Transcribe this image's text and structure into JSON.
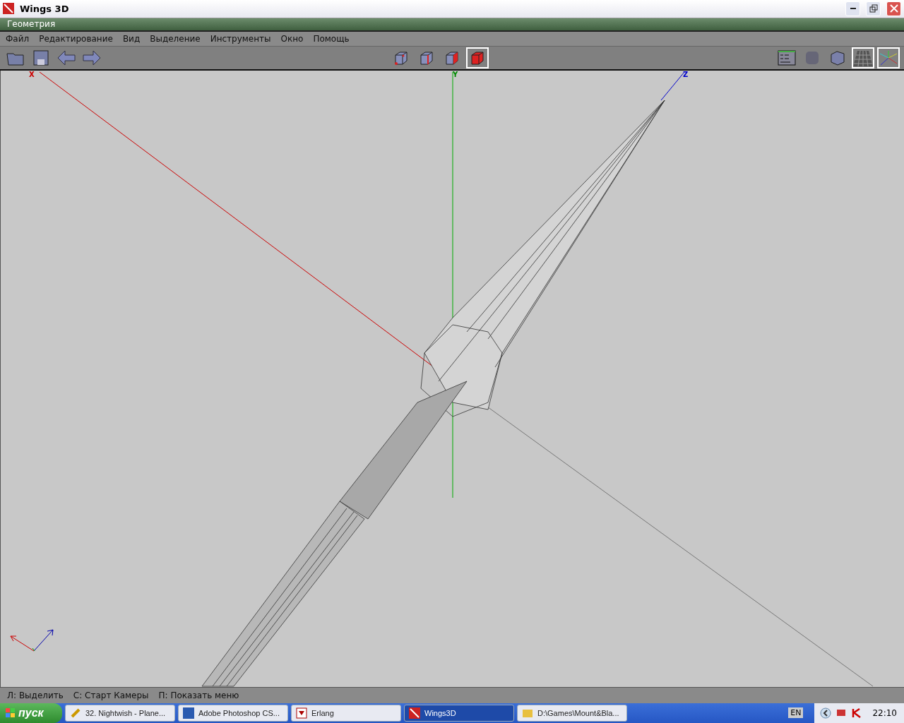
{
  "window": {
    "title": "Wings 3D"
  },
  "geometry_bar": {
    "title": "Геометрия"
  },
  "menu": [
    "Файл",
    "Редактирование",
    "Вид",
    "Выделение",
    "Инструменты",
    "Окно",
    "Помощь"
  ],
  "select_modes": [
    {
      "kind": "vertex",
      "selected": false
    },
    {
      "kind": "edge",
      "selected": false
    },
    {
      "kind": "face",
      "selected": false
    },
    {
      "kind": "body",
      "selected": true
    }
  ],
  "view_buttons": [
    {
      "kind": "outliner",
      "selected": false
    },
    {
      "kind": "smooth",
      "selected": false
    },
    {
      "kind": "flat",
      "selected": false
    },
    {
      "kind": "ground",
      "selected": true
    },
    {
      "kind": "axes",
      "selected": true
    }
  ],
  "viewport": {
    "axis_labels": [
      "X",
      "Y",
      "Z"
    ]
  },
  "status_bar": [
    "Л: Выделить",
    "С: Старт Камеры",
    "П: Показать меню"
  ],
  "taskbar": {
    "start": "пуск",
    "items": [
      {
        "kind": "player",
        "label": "32. Nightwish - Plane...",
        "selected": false
      },
      {
        "kind": "ps",
        "label": "Adobe Photoshop CS...",
        "selected": false
      },
      {
        "kind": "erlang",
        "label": "Erlang",
        "selected": false
      },
      {
        "kind": "wings",
        "label": "Wings3D",
        "selected": true
      },
      {
        "kind": "folder",
        "label": "D:\\Games\\Mount&Bla...",
        "selected": false
      }
    ],
    "language": "EN",
    "clock": "22:10"
  }
}
